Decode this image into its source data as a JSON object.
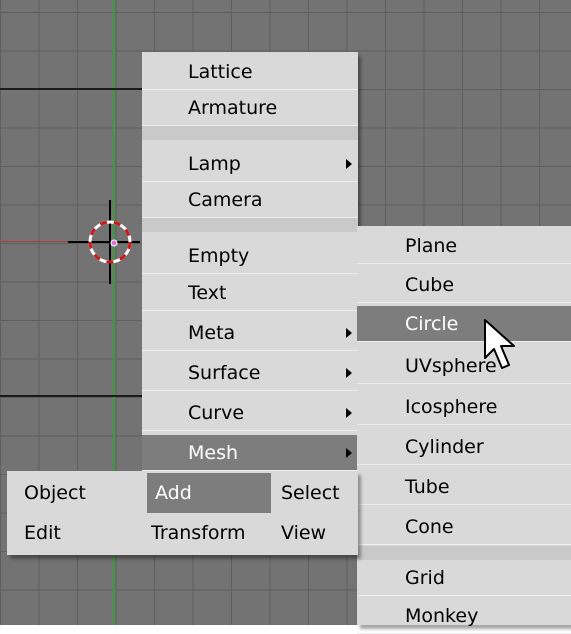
{
  "add_menu": {
    "items": [
      {
        "label": "Lattice"
      },
      {
        "label": "Armature"
      },
      {
        "label": "Lamp"
      },
      {
        "label": "Camera"
      },
      {
        "label": "Empty"
      },
      {
        "label": "Text"
      },
      {
        "label": "Meta"
      },
      {
        "label": "Surface"
      },
      {
        "label": "Curve"
      },
      {
        "label": "Mesh"
      }
    ]
  },
  "mesh_menu": {
    "items": [
      {
        "label": "Plane"
      },
      {
        "label": "Cube"
      },
      {
        "label": "Circle"
      },
      {
        "label": "UVsphere"
      },
      {
        "label": "Icosphere"
      },
      {
        "label": "Cylinder"
      },
      {
        "label": "Tube"
      },
      {
        "label": "Cone"
      },
      {
        "label": "Grid"
      },
      {
        "label": "Monkey"
      }
    ]
  },
  "header_menu": {
    "row1": [
      "Object",
      "Add",
      "Select"
    ],
    "row2": [
      "Edit",
      "Transform",
      "View"
    ]
  },
  "colors": {
    "viewport_bg": "#737373",
    "menu_bg": "#d9d9d9",
    "highlight": "#7d7d7d",
    "x_axis": "#b03a3a",
    "y_axis": "#3d9a3d"
  }
}
